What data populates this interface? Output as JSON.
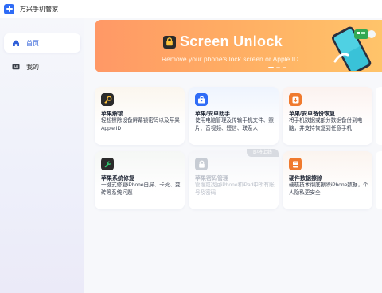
{
  "app": {
    "title": "万兴手机管家"
  },
  "sidebar": {
    "items": [
      {
        "label": "首页",
        "icon": "home-icon",
        "active": true
      },
      {
        "label": "我的",
        "icon": "profile-card-icon",
        "active": false
      }
    ]
  },
  "banner": {
    "title": "Screen Unlock",
    "subtitle": "Remove your phone's lock screen or Apple ID",
    "icon": "padlock-icon"
  },
  "cards": [
    {
      "title": "苹果解锁",
      "desc": "轻松擦除设备屏幕锁密码以及苹果Apple ID",
      "icon": "key-icon",
      "color": "#2b2b2b"
    },
    {
      "title": "苹果/安卓助手",
      "desc": "使用电脑管理及传输手机文件、照片、音视频、短信、联系人",
      "icon": "toolbox-icon",
      "color": "#2f6cf6"
    },
    {
      "title": "苹果/安卓备份恢复",
      "desc": "将手机数据或部分数据备份到电脑，并支持恢复到任意手机",
      "icon": "backup-icon",
      "color": "#f07a2e"
    },
    {
      "title": "苹果系统修复",
      "desc": "一键式修复iPhone白屏、卡死、变砖等系统问题",
      "icon": "wrench-icon",
      "color": "#1f9d5a"
    },
    {
      "title": "苹果密码管理",
      "desc": "管理或找回iPhone和iPad中所有账号及密码",
      "icon": "password-lock-icon",
      "color": "#c7ccd4",
      "badge": "即将上线",
      "disabled": true
    },
    {
      "title": "硬件数据擦除",
      "desc": "硬核技术彻底擦除iPhone数据，个人隐私更安全",
      "icon": "eraser-icon",
      "color": "#f07a2e"
    }
  ],
  "colors": {
    "accent": "#2f6cf6",
    "banner_start": "#ff9866",
    "banner_end": "#ffc46a"
  }
}
